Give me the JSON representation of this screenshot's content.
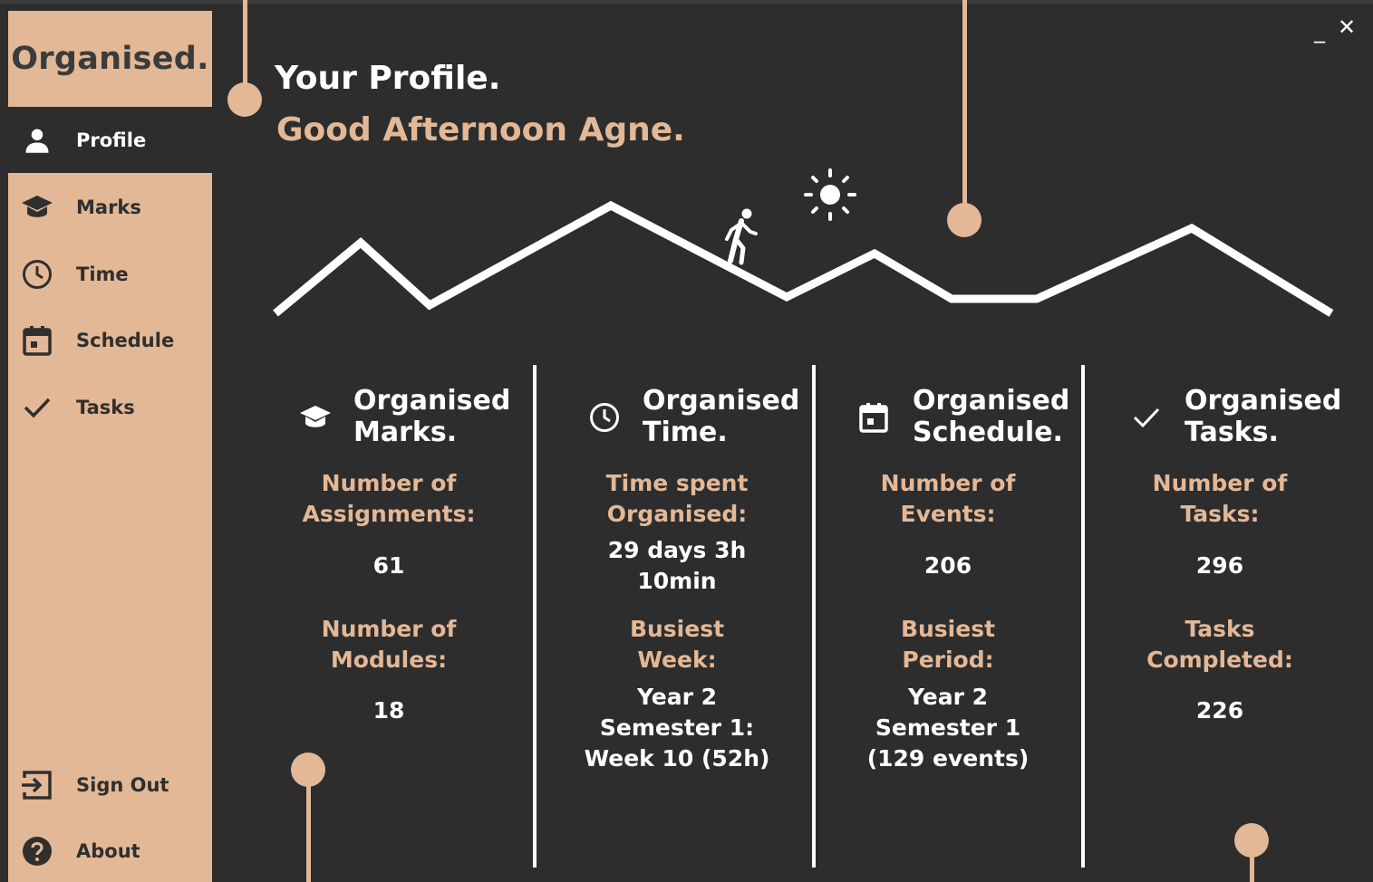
{
  "app": {
    "brand": "Organised.",
    "accent_color": "#e3b896",
    "background_color": "#2d2d2d"
  },
  "window_controls": {
    "minimize": "_",
    "close": "✕"
  },
  "sidebar": {
    "items": [
      {
        "label": "Profile",
        "icon": "person-icon",
        "active": true
      },
      {
        "label": "Marks",
        "icon": "graduation-cap-icon",
        "active": false
      },
      {
        "label": "Time",
        "icon": "clock-icon",
        "active": false
      },
      {
        "label": "Schedule",
        "icon": "calendar-icon",
        "active": false
      },
      {
        "label": "Tasks",
        "icon": "checkmark-icon",
        "active": false
      }
    ],
    "bottom_items": [
      {
        "label": "Sign Out",
        "icon": "sign-out-icon"
      },
      {
        "label": "About",
        "icon": "help-icon"
      }
    ]
  },
  "header": {
    "title": "Your Profile.",
    "greeting": "Good Afternoon Agne."
  },
  "stats": [
    {
      "title": "Organised\nMarks.",
      "icon": "graduation-cap-icon",
      "label1": "Number of\nAssignments:",
      "value1": "61",
      "label2": "Number of\nModules:",
      "value2": "18"
    },
    {
      "title": "Organised\nTime.",
      "icon": "clock-icon",
      "label1": "Time spent\nOrganised:",
      "value1": "29 days 3h\n10min",
      "label2": "Busiest\nWeek:",
      "value2": "Year 2\nSemester 1:\nWeek 10 (52h)"
    },
    {
      "title": "Organised\nSchedule.",
      "icon": "calendar-icon",
      "label1": "Number of\nEvents:",
      "value1": "206",
      "label2": "Busiest\nPeriod:",
      "value2": "Year 2\nSemester 1\n(129 events)"
    },
    {
      "title": "Organised\nTasks.",
      "icon": "checkmark-icon",
      "label1": "Number of\nTasks:",
      "value1": "296",
      "label2": "Tasks\nCompleted:",
      "value2": "226"
    }
  ]
}
